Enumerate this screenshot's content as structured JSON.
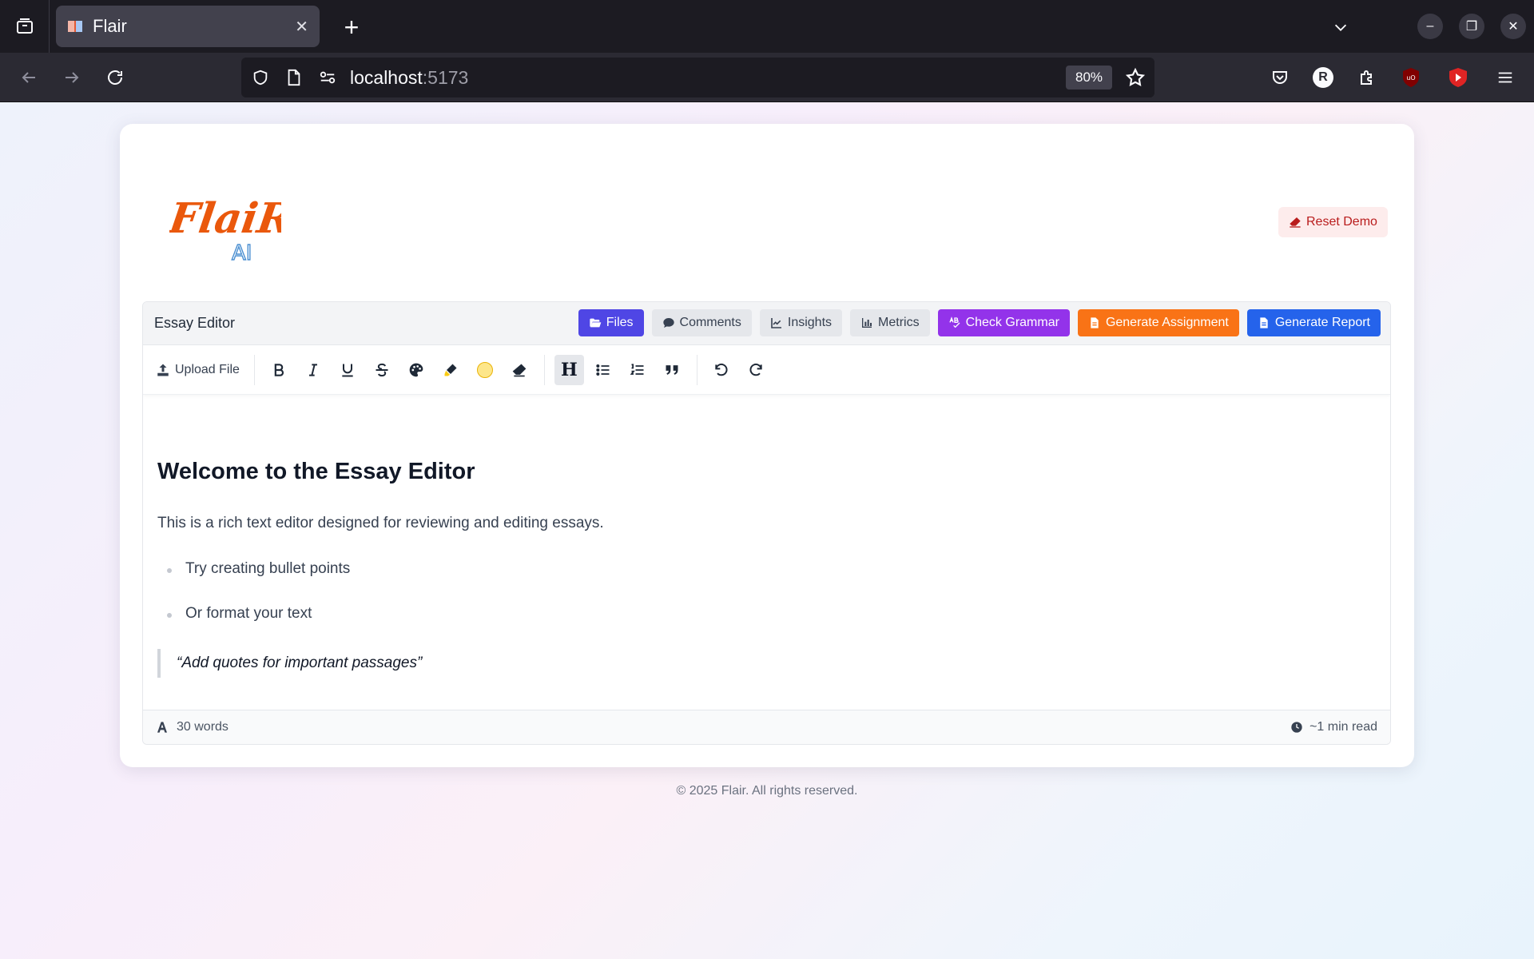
{
  "browser": {
    "tab_title": "Flair",
    "url_host": "localhost",
    "url_port": ":5173",
    "zoom": "80%",
    "profile_initial": "R"
  },
  "app": {
    "logo_text": "FlaiR",
    "logo_sub": "AI",
    "reset_label": "Reset Demo",
    "colors": {
      "brand": "#ea580c",
      "accent": "#4f46e5",
      "purple": "#9333ea",
      "orange": "#f97316",
      "blue": "#2563eb",
      "danger": "#b91c1c"
    }
  },
  "editor": {
    "title": "Essay Editor",
    "buttons": {
      "files": "Files",
      "comments": "Comments",
      "insights": "Insights",
      "metrics": "Metrics",
      "grammar": "Check Grammar",
      "assignment": "Generate Assignment",
      "report": "Generate Report"
    },
    "toolbar": {
      "upload": "Upload File",
      "heading_glyph": "H"
    },
    "document": {
      "heading": "Welcome to the Essay Editor",
      "paragraph": "This is a rich text editor designed for reviewing and editing essays.",
      "bullets": [
        "Try creating bullet points",
        "Or format your text"
      ],
      "quote": "“Add quotes for important passages”"
    },
    "footer": {
      "words": "30 words",
      "read_time": "~1 min read"
    }
  },
  "footer": {
    "copyright": "© 2025 Flair. All rights reserved."
  }
}
